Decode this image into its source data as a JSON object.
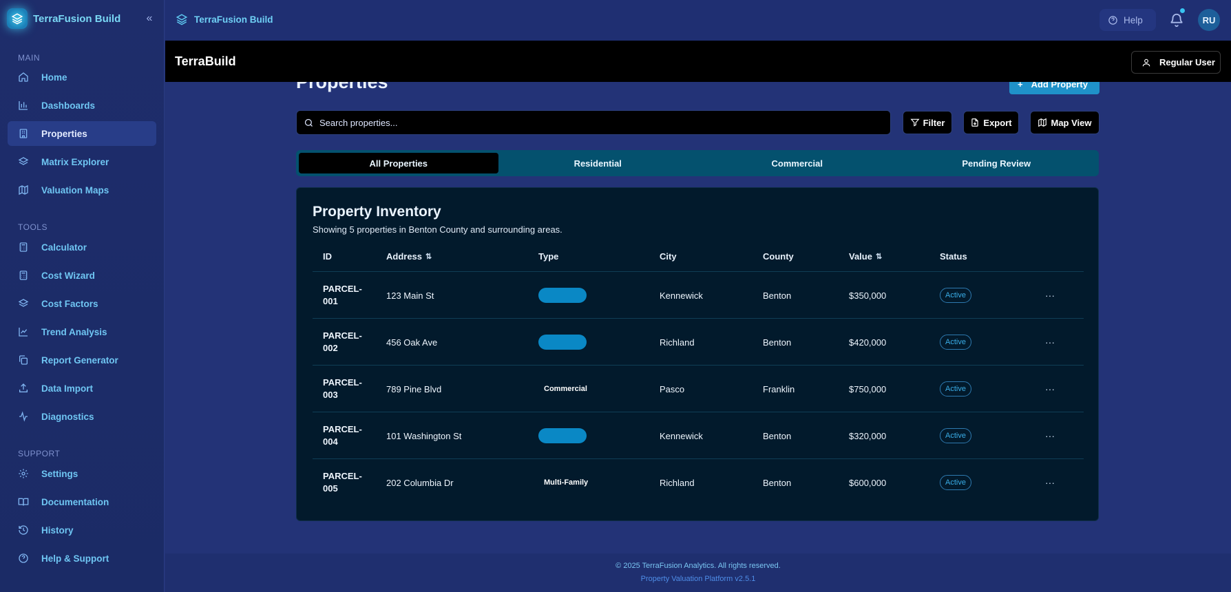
{
  "sidebar": {
    "brand": "TerraFusion Build",
    "collapse_icon": "chevrons-left-icon",
    "sections": {
      "main": "MAIN",
      "tools": "TOOLS",
      "support": "SUPPORT"
    },
    "items": [
      {
        "label": "Home",
        "icon": "home-icon"
      },
      {
        "label": "Dashboards",
        "icon": "bar-chart-icon"
      },
      {
        "label": "Properties",
        "icon": "building-icon",
        "active": true
      },
      {
        "label": "Matrix Explorer",
        "icon": "layers-icon"
      },
      {
        "label": "Valuation Maps",
        "icon": "map-icon"
      },
      {
        "label": "Calculator",
        "icon": "calculator-icon"
      },
      {
        "label": "Cost Wizard",
        "icon": "calculator-icon"
      },
      {
        "label": "Cost Factors",
        "icon": "layers-icon"
      },
      {
        "label": "Trend Analysis",
        "icon": "line-chart-icon"
      },
      {
        "label": "Report Generator",
        "icon": "copy-icon"
      },
      {
        "label": "Data Import",
        "icon": "upload-icon"
      },
      {
        "label": "Diagnostics",
        "icon": "activity-icon"
      },
      {
        "label": "Settings",
        "icon": "gear-icon"
      },
      {
        "label": "Documentation",
        "icon": "book-icon"
      },
      {
        "label": "History",
        "icon": "history-icon"
      },
      {
        "label": "Help & Support",
        "icon": "help-circle-icon"
      }
    ]
  },
  "topbar": {
    "brand": "TerraFusion Build",
    "help_label": "Help",
    "avatar_initials": "RU"
  },
  "appbar": {
    "title": "TerraBuild",
    "user_label": "Regular User"
  },
  "page": {
    "title": "Properties",
    "add_button": "Add Property"
  },
  "search": {
    "placeholder": "Search properties..."
  },
  "toolbar": {
    "filter": "Filter",
    "export": "Export",
    "map_view": "Map View"
  },
  "tabs": [
    "All Properties",
    "Residential",
    "Commercial",
    "Pending Review"
  ],
  "inventory": {
    "title": "Property Inventory",
    "subtitle": "Showing 5 properties in Benton County and surrounding areas.",
    "columns": [
      "ID",
      "Address",
      "Type",
      "City",
      "County",
      "Value",
      "Status"
    ],
    "sort_glyph": "⇅",
    "rows": [
      {
        "id": "PARCEL-001",
        "address": "123 Main St",
        "type": "",
        "city": "Kennewick",
        "county": "Benton",
        "value": "$350,000",
        "status": "Active"
      },
      {
        "id": "PARCEL-002",
        "address": "456 Oak Ave",
        "type": "",
        "city": "Richland",
        "county": "Benton",
        "value": "$420,000",
        "status": "Active"
      },
      {
        "id": "PARCEL-003",
        "address": "789 Pine Blvd",
        "type": "Commercial",
        "city": "Pasco",
        "county": "Franklin",
        "value": "$750,000",
        "status": "Active"
      },
      {
        "id": "PARCEL-004",
        "address": "101 Washington St",
        "type": "",
        "city": "Kennewick",
        "county": "Benton",
        "value": "$320,000",
        "status": "Active"
      },
      {
        "id": "PARCEL-005",
        "address": "202 Columbia Dr",
        "type": "Multi-Family",
        "city": "Richland",
        "county": "Benton",
        "value": "$600,000",
        "status": "Active"
      }
    ]
  },
  "footer": {
    "copyright": "© 2025 TerraFusion Analytics. All rights reserved.",
    "version": "Property Valuation Platform v2.5.1"
  },
  "colors": {
    "background": "#233377",
    "accent": "#1f92c9",
    "tab_bar": "#04516e",
    "card": "#021a2c"
  }
}
